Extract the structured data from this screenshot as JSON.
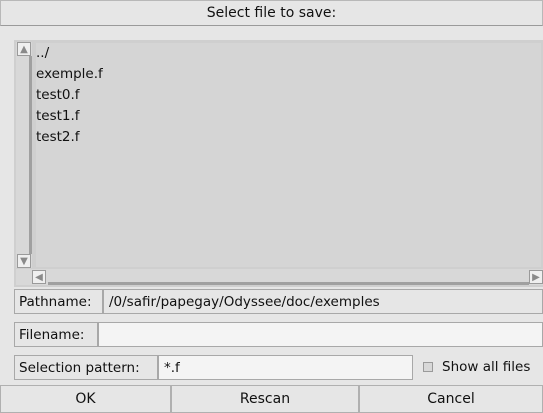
{
  "dialog": {
    "title": "Select file to save:"
  },
  "file_list": {
    "items": [
      "../",
      "exemple.f",
      "test0.f",
      "test1.f",
      "test2.f"
    ]
  },
  "pathname": {
    "label": "Pathname:",
    "value": "/0/safir/papegay/Odyssee/doc/exemples"
  },
  "filename": {
    "label": "Filename:",
    "value": ""
  },
  "selection_pattern": {
    "label": "Selection pattern:",
    "value": "*.f",
    "show_all_label": "Show all files",
    "show_all_checked": false
  },
  "buttons": {
    "ok": "OK",
    "rescan": "Rescan",
    "cancel": "Cancel"
  }
}
